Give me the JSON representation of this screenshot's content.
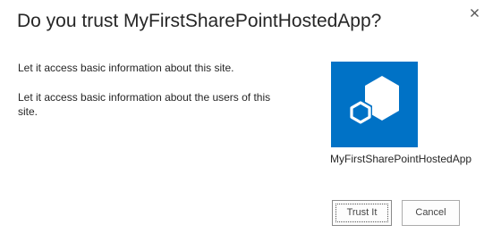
{
  "dialog": {
    "title": "Do you trust MyFirstSharePointHostedApp?",
    "close_icon": "close-icon"
  },
  "permissions": [
    "Let it access basic information about this site.",
    "Let it access basic information about the users of this site."
  ],
  "app": {
    "name": "MyFirstSharePointHostedApp",
    "icon": "app-cubes-icon",
    "tile_color": "#0072c6"
  },
  "buttons": {
    "trust_label": "Trust It",
    "cancel_label": "Cancel"
  }
}
